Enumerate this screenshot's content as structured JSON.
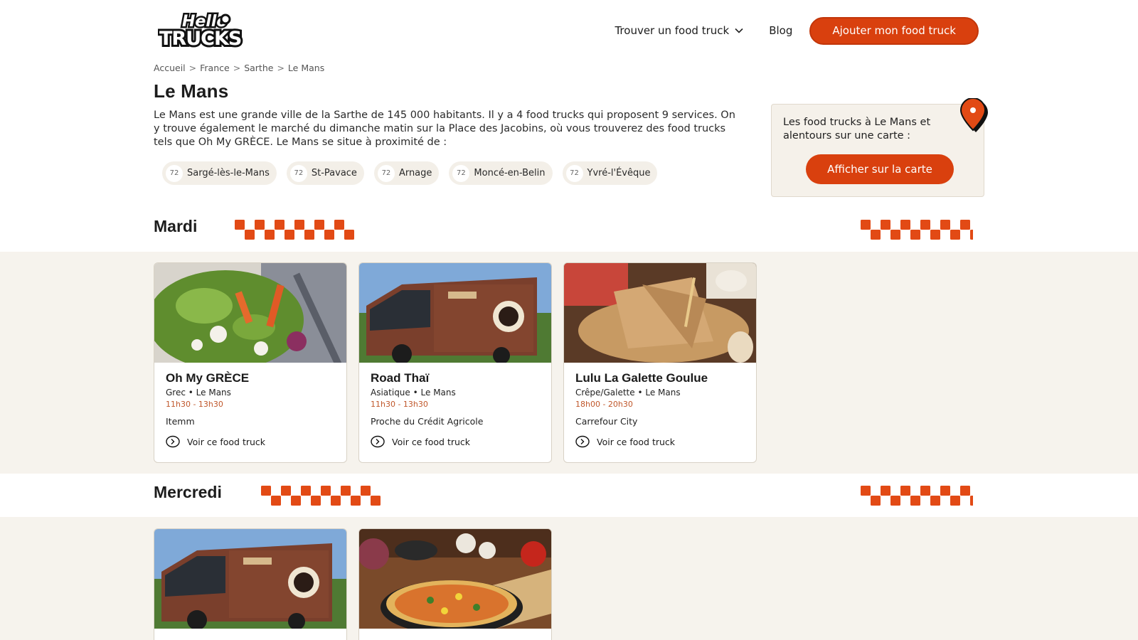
{
  "header": {
    "logo_text_top": "Hello",
    "logo_text_bottom": "TRUCKS",
    "nav_find": "Trouver un food truck",
    "nav_blog": "Blog",
    "cta": "Ajouter mon food truck"
  },
  "breadcrumb": [
    "Accueil",
    "France",
    "Sarthe",
    "Le Mans"
  ],
  "breadcrumb_sep": ">",
  "page": {
    "title": "Le Mans",
    "intro": "Le Mans est une grande ville de la Sarthe de 145 000 habitants. Il y a 4 food trucks qui proposent 9 services. On y trouve également le marché du dimanche matin sur la Place des Jacobins, où vous trouverez des food trucks tels que Oh My GRÈCE. Le Mans se situe à proximité de :"
  },
  "nearby": [
    {
      "dept": "72",
      "name": "Sargé-lès-le-Mans"
    },
    {
      "dept": "72",
      "name": "St-Pavace"
    },
    {
      "dept": "72",
      "name": "Arnage"
    },
    {
      "dept": "72",
      "name": "Moncé-en-Belin"
    },
    {
      "dept": "72",
      "name": "Yvré-l'Évêque"
    }
  ],
  "map_card": {
    "text": "Les food trucks à Le Mans et alentours sur une carte :",
    "button": "Afficher sur la carte"
  },
  "days": [
    {
      "name": "Mardi",
      "trucks": [
        {
          "name": "Oh My GRÈCE",
          "cuisine": "Grec",
          "city": "Le Mans",
          "hours": "11h30 - 13h30",
          "place": "Itemm",
          "link": "Voir ce food truck",
          "image": "salad"
        },
        {
          "name": "Road Thaï",
          "cuisine": "Asiatique",
          "city": "Le Mans",
          "hours": "11h30 - 13h30",
          "place": "Proche du Crédit Agricole",
          "link": "Voir ce food truck",
          "image": "truck"
        },
        {
          "name": "Lulu La Galette Goulue",
          "cuisine": "Crêpe/Galette",
          "city": "Le Mans",
          "hours": "18h00 - 20h30",
          "place": "Carrefour City",
          "link": "Voir ce food truck",
          "image": "galette"
        }
      ]
    },
    {
      "name": "Mercredi",
      "trucks": [
        {
          "image": "truck"
        },
        {
          "image": "pizza"
        }
      ]
    }
  ],
  "colors": {
    "accent": "#d9400e",
    "hours": "#c0572b",
    "band": "#f6f3ed"
  }
}
